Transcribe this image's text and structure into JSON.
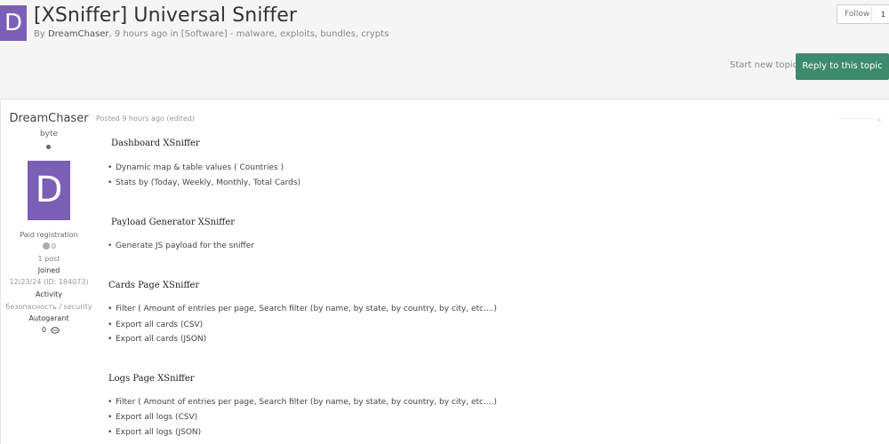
{
  "topic": {
    "avatar_letter": "D",
    "title": "[XSniffer] Universal Sniffer",
    "meta_prefix": "By",
    "meta_author": "DreamChaser",
    "meta_time": ", 9 hours ago in",
    "meta_forum": "[Software] - malware, exploits, bundles, crypts"
  },
  "follow": {
    "label": "Follow",
    "count": "1"
  },
  "actions": {
    "start_new_topic": "Start new topic",
    "reply": "Reply to this topic"
  },
  "author": {
    "name": "DreamChaser",
    "title": "byte",
    "avatar_letter": "D",
    "group": "Paid registration",
    "reputation": "0",
    "posts": "1 post",
    "joined_label": "Joined",
    "joined_value": "12/23/24 (ID: 184073)",
    "activity_label": "Activity",
    "activity_value": "безопасность / security",
    "autogarant_label": "Autogarant",
    "autogarant_value": "0"
  },
  "post": {
    "posted": "Posted 9 hours ago (edited)",
    "sections": [
      {
        "heading": "Dashboard XSniffer",
        "items": [
          "Dynamic map & table values ( Countries )",
          "Stats by (Today, Weekly, Monthly, Total Cards)"
        ]
      },
      {
        "heading": "Payload Generator XSniffer",
        "items": [
          "Generate JS payload for the sniffer"
        ]
      },
      {
        "heading": "Cards Page  XSniffer",
        "items": [
          "Filter ( Amount of entries per page, Search filter (by name, by state, by country, by city, etc....)",
          "Export all cards (CSV)",
          "Export all cards (JSON)"
        ]
      },
      {
        "heading": "Logs Page XSniffer",
        "items": [
          "Filter ( Amount of entries per page, Search filter (by name, by state, by country, by city, etc....)",
          "Export all logs (CSV)",
          "Export all logs (JSON)"
        ]
      }
    ]
  },
  "colors": {
    "avatar": "#7b5fb7",
    "reply_button": "#3d8b6d"
  },
  "icons": {
    "share": "share-icon",
    "autogarant": "handshake-icon"
  }
}
